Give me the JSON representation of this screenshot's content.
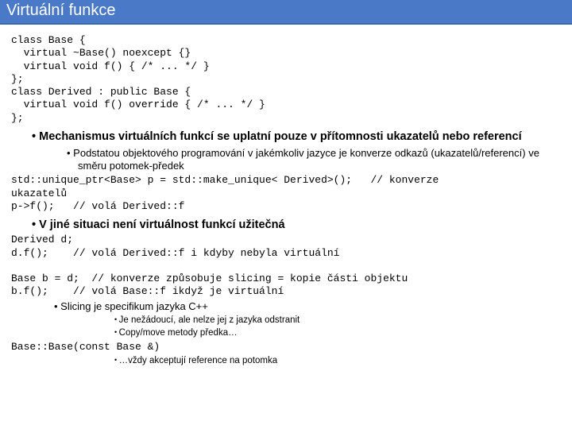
{
  "title": "Virtuální funkce",
  "code1": "class Base {\n  virtual ~Base() noexcept {}\n  virtual void f() { /* ... */ }\n};\nclass Derived : public Base {\n  virtual void f() override { /* ... */ }\n};",
  "b1_1": "Mechanismus virtuálních funkcí se uplatní pouze v přítomnosti ukazatelů nebo referencí",
  "b2_1": "Podstatou objektového programování v jakémkoliv jazyce je konverze odkazů (ukazatelů/referencí) ve směru potomek-předek",
  "code2": "std::unique_ptr<Base> p = std::make_unique< Derived>();   // konverze\nukazatelů\np->f();   // volá Derived::f",
  "b1_2": "V jiné situaci není virtuálnost funkcí užitečná",
  "code3": "Derived d;\nd.f();    // volá Derived::f i kdyby nebyla virtuální\n\nBase b = d;  // konverze způsobuje slicing = kopie části objektu\nb.f();    // volá Base::f ikdyž je virtuální",
  "b2_2": "Slicing je specifikum jazyka C++",
  "b3_1": "Je nežádoucí, ale nelze jej z jazyka odstranit",
  "b3_2": "Copy/move metody předka…",
  "code4": "Base::Base(const Base &)",
  "b3_3": "…vždy akceptují reference na potomka"
}
